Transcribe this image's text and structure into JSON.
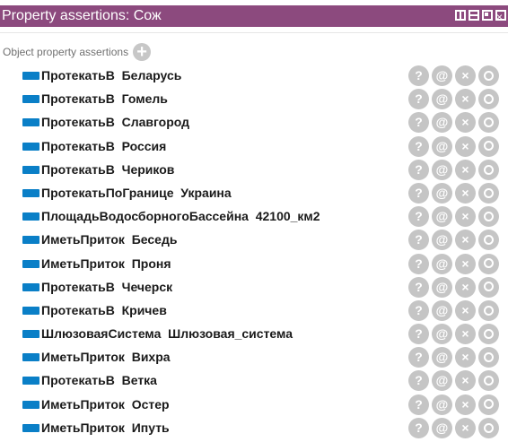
{
  "panel": {
    "title": "Property assertions: Сож"
  },
  "section": {
    "label": "Object property assertions",
    "add_icon": "+"
  },
  "actions": {
    "help": "?",
    "annotate": "@",
    "delete": "×"
  },
  "assertions": [
    {
      "text": "ПротекатьВ  Беларусь"
    },
    {
      "text": "ПротекатьВ  Гомель"
    },
    {
      "text": "ПротекатьВ  Славгород"
    },
    {
      "text": "ПротекатьВ  Россия"
    },
    {
      "text": "ПротекатьВ  Чериков"
    },
    {
      "text": "ПротекатьПоГранице  Украина"
    },
    {
      "text": "ПлощадьВодосборногоБассейна  42100_км2"
    },
    {
      "text": "ИметьПриток  Беседь"
    },
    {
      "text": "ИметьПриток  Проня"
    },
    {
      "text": "ПротекатьВ  Чечерск"
    },
    {
      "text": "ПротекатьВ  Кричев"
    },
    {
      "text": "ШлюзоваяСистема  Шлюзовая_система"
    },
    {
      "text": "ИметьПриток  Вихра"
    },
    {
      "text": "ПротекатьВ  Ветка"
    },
    {
      "text": "ИметьПриток  Остер"
    },
    {
      "text": "ИметьПриток  Ипуть"
    }
  ],
  "colors": {
    "titlebar": "#8c4a7e",
    "property_bar": "#0a7fc7",
    "action_button": "#c5c5c5"
  }
}
